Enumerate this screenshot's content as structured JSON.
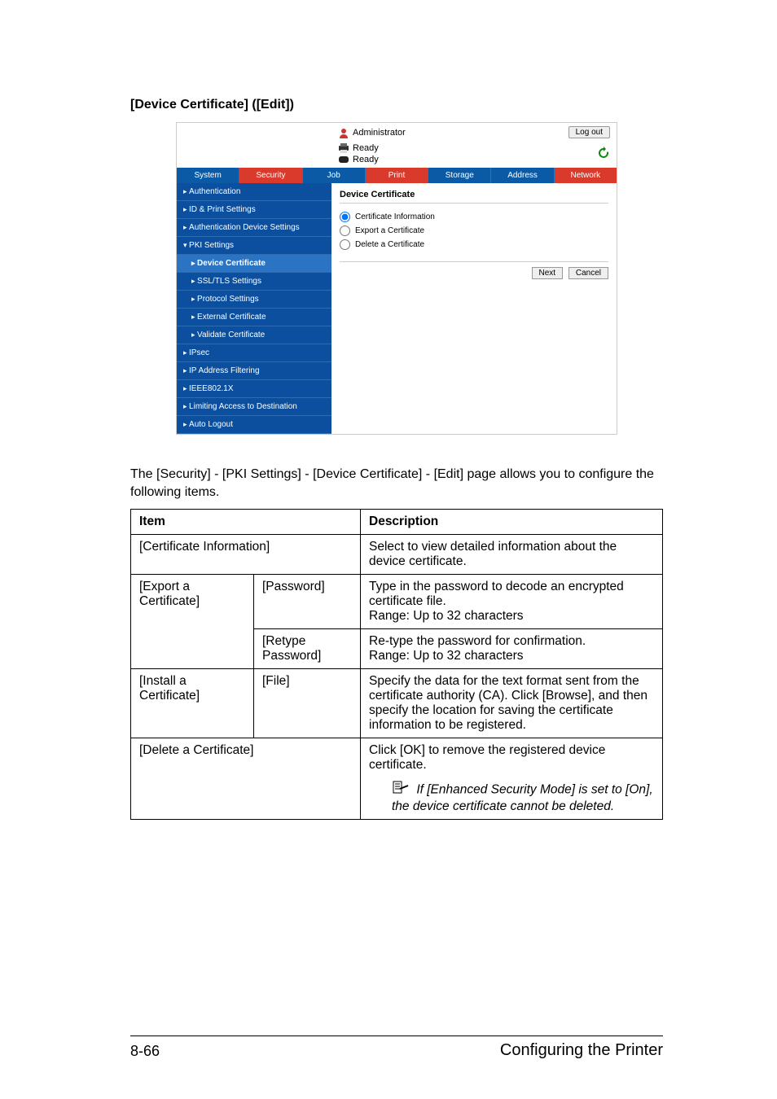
{
  "page": {
    "section_title": "[Device Certificate] ([Edit])",
    "caption": "The [Security] - [PKI Settings] - [Device Certificate] - [Edit] page allows you to configure the following items.",
    "footer_left": "8-66",
    "footer_right": "Configuring the Printer"
  },
  "shot": {
    "admin_label": "Administrator",
    "logout": "Log out",
    "ready1": "Ready",
    "ready2": "Ready",
    "tabs": {
      "system": "System",
      "security": "Security",
      "job": "Job",
      "print": "Print",
      "storage": "Storage",
      "address": "Address",
      "network": "Network"
    },
    "sidebar": {
      "authentication": "Authentication",
      "id_print": "ID & Print Settings",
      "auth_device": "Authentication Device Settings",
      "pki": "PKI Settings",
      "device_cert": "Device Certificate",
      "ssl": "SSL/TLS Settings",
      "protocol": "Protocol Settings",
      "external_cert": "External Certificate",
      "validate_cert": "Validate Certificate",
      "ipsec": "IPsec",
      "ip_filter": "IP Address Filtering",
      "ieee": "IEEE802.1X",
      "limiting": "Limiting Access to Destination",
      "auto_logout": "Auto Logout"
    },
    "content": {
      "title": "Device Certificate",
      "opt1": "Certificate Information",
      "opt2": "Export a Certificate",
      "opt3": "Delete a Certificate",
      "next": "Next",
      "cancel": "Cancel"
    }
  },
  "table": {
    "h_item": "Item",
    "h_desc": "Description",
    "r1_item": "[Certificate Information]",
    "r1_desc": "Select to view detailed information about the device certificate.",
    "r2_item_a": "[Export a Certificate]",
    "r2_item_b1": "[Password]",
    "r2_desc_b1": "Type in the password to decode an encrypted certificate file.\nRange: Up to 32 characters",
    "r2_item_b2": "[Retype Password]",
    "r2_desc_b2": "Re-type the password for confirmation.\nRange: Up to 32 characters",
    "r3_item_a": "[Install a Certificate]",
    "r3_item_b": "[File]",
    "r3_desc": "Specify the data for the text format sent from the certificate authority (CA). Click [Browse], and then specify the location for saving the certificate information to be registered.",
    "r4_item": "[Delete a Certificate]",
    "r4_desc_main": "Click [OK] to remove the registered device certificate.",
    "r4_desc_note": "If [Enhanced Security Mode] is set to [On], the device certificate cannot be deleted."
  }
}
